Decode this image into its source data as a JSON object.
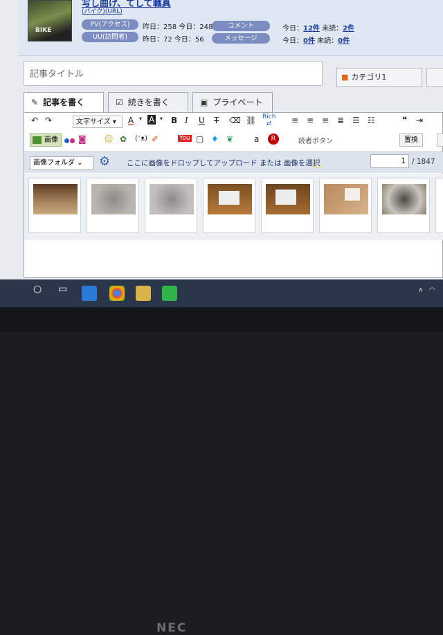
{
  "stats": {
    "title_link": "写し曲げ、てして職真",
    "sub_links": "(バイク)(URL)",
    "thumb_label": "BIKE",
    "pv_label": "PV(アクセス)",
    "pv_values": "昨日：258 今日：248",
    "uu_label": "UU(訪問者)",
    "uu_values": "昨日：72 今日：56",
    "comment_label": "コメント",
    "comment_today": "今日：",
    "comment_today_val": "12件",
    "comment_unread": "未読：",
    "comment_unread_val": "2件",
    "message_label": "メッセージ",
    "message_today": "今日：",
    "message_today_val": "0件",
    "message_unread": "未読：",
    "message_unread_val": "0件"
  },
  "title_placeholder": "記事タイトル",
  "category_button": "カテゴリ1",
  "tabs": [
    {
      "label": "記事を書く",
      "icon": "pencil-icon"
    },
    {
      "label": "続きを書く",
      "icon": "edit-icon"
    },
    {
      "label": "プライベート",
      "icon": "private-icon"
    }
  ],
  "toolbar": {
    "font_size": "文字サイズ",
    "rich_label": "Rich",
    "image_label": "画像",
    "reader_button": "読者ボタン",
    "replace_label": "置換"
  },
  "media": {
    "folder_select": "画像フォルダ",
    "drop_text": "ここに画像をドロップしてアップロード または 画像を選択",
    "page_value": "1",
    "page_total": "/ 1847"
  },
  "monitor_brand": "NEC",
  "colors": {
    "accent": "#3b62a8",
    "pill": "#7b8cc0",
    "folder": "#e0661a"
  }
}
